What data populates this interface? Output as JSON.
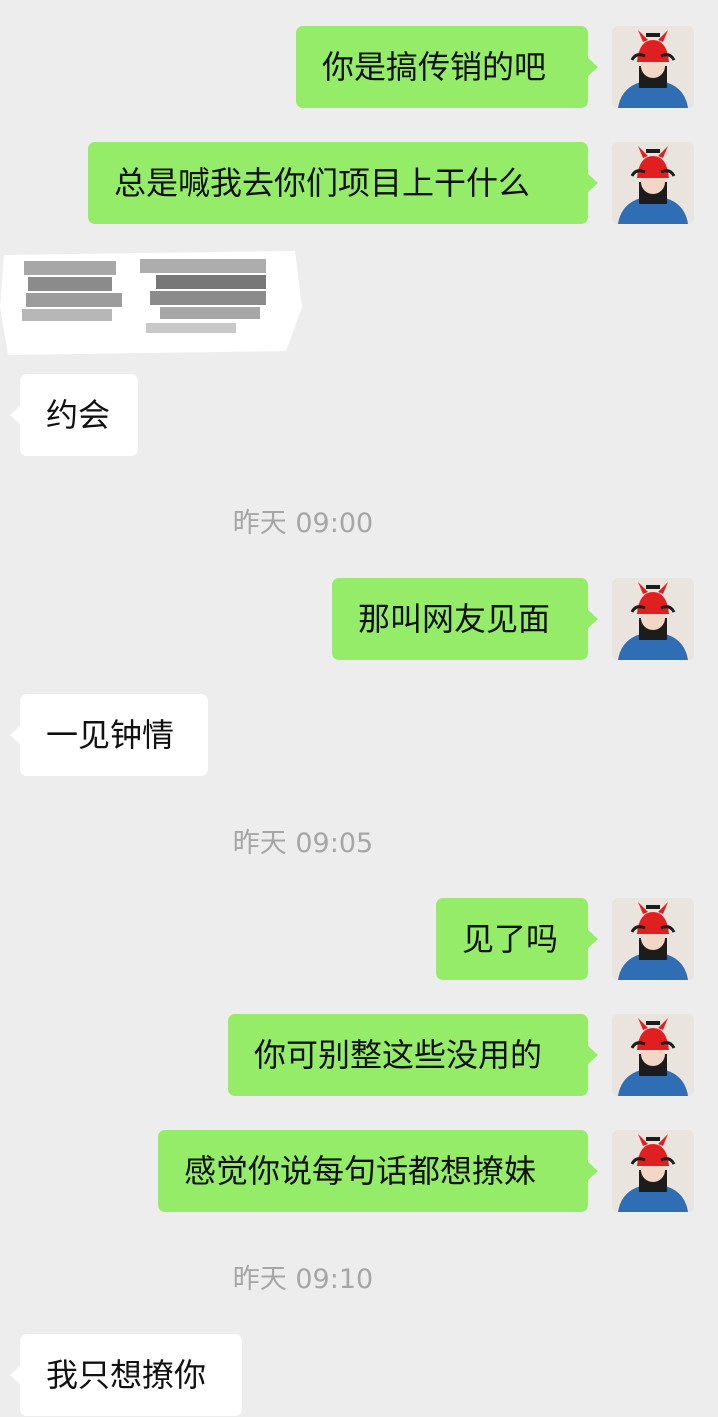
{
  "chat": {
    "messages": [
      {
        "kind": "out",
        "text": "你是搞传销的吧"
      },
      {
        "kind": "out",
        "text": "总是喊我去你们项目上干什么"
      },
      {
        "kind": "in-redacted"
      },
      {
        "kind": "in",
        "text": "约会"
      },
      {
        "kind": "time",
        "text": "昨天 09:00"
      },
      {
        "kind": "out",
        "text": "那叫网友见面"
      },
      {
        "kind": "in",
        "text": "一见钟情"
      },
      {
        "kind": "time",
        "text": "昨天 09:05"
      },
      {
        "kind": "out",
        "text": "见了吗"
      },
      {
        "kind": "out",
        "text": "你可别整这些没用的"
      },
      {
        "kind": "out",
        "text": "感觉你说每句话都想撩妹"
      },
      {
        "kind": "time",
        "text": "昨天 09:10"
      },
      {
        "kind": "in",
        "text": "我只想撩你"
      }
    ]
  },
  "colors": {
    "background": "#ededed",
    "outgoing_bubble": "#95ec69",
    "incoming_bubble": "#ffffff",
    "timestamp_text": "#a6a6a6",
    "avatar_hat": "#e02020",
    "avatar_jacket": "#2f6db5"
  },
  "icons": {
    "avatar": "avatar-girl-red-hat-icon"
  }
}
